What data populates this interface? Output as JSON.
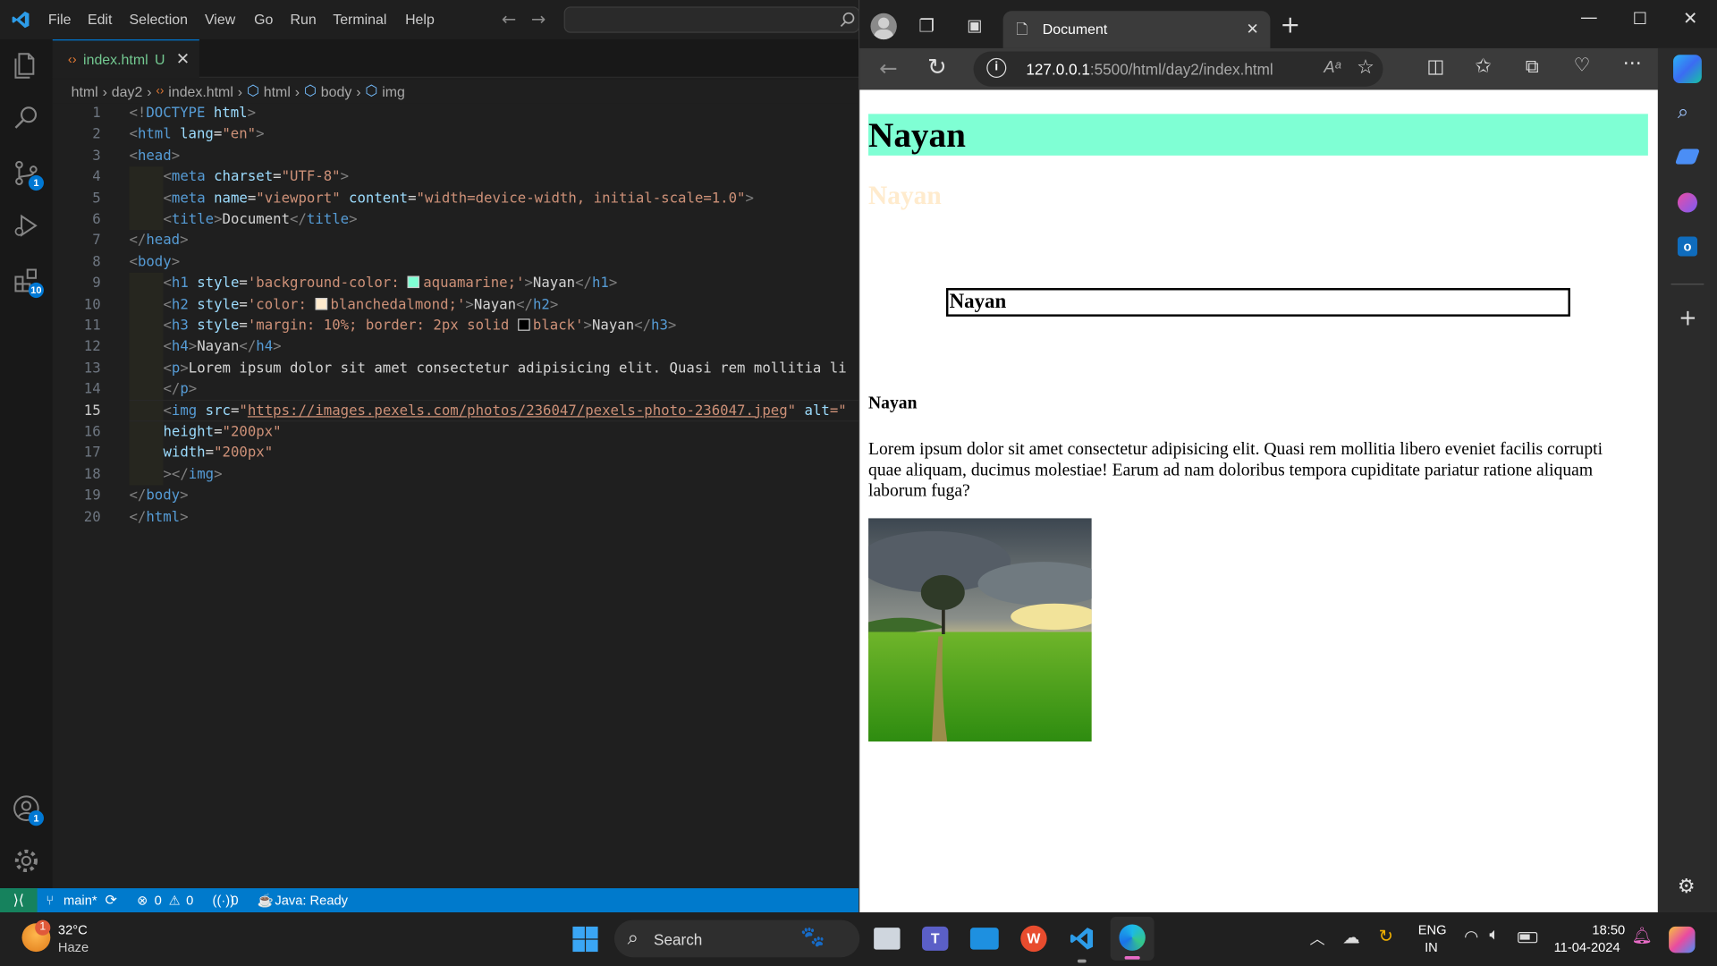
{
  "vscode": {
    "menu": [
      "File",
      "Edit",
      "Selection",
      "View",
      "Go",
      "Run",
      "Terminal",
      "Help"
    ],
    "activity_badges": {
      "scm": "1",
      "extensions": "10",
      "accounts": "1"
    },
    "tab": {
      "label": "index.html",
      "status": "U"
    },
    "breadcrumb": [
      "html",
      "day2",
      "index.html",
      "html",
      "body",
      "img"
    ],
    "line_numbers": [
      "1",
      "2",
      "3",
      "4",
      "5",
      "6",
      "7",
      "8",
      "9",
      "10",
      "11",
      "12",
      "13",
      "14",
      "15",
      "16",
      "17",
      "18",
      "19",
      "20"
    ],
    "current_line": "15",
    "code": {
      "l1": [
        "<!",
        "DOCTYPE",
        " html",
        ">"
      ],
      "l2": [
        "<",
        "html",
        " lang",
        "=",
        "\"en\"",
        ">"
      ],
      "l3": [
        "<",
        "head",
        ">"
      ],
      "l4": [
        "<",
        "meta",
        " charset",
        "=",
        "\"UTF-8\"",
        ">"
      ],
      "l5": [
        "<",
        "meta",
        " name",
        "=",
        "\"viewport\"",
        " content",
        "=",
        "\"width=device-width, initial-scale=1.0\"",
        ">"
      ],
      "l6": [
        "<",
        "title",
        ">",
        "Document",
        "</",
        "title",
        ">"
      ],
      "l7": [
        "</",
        "head",
        ">"
      ],
      "l8": [
        "<",
        "body",
        ">"
      ],
      "l9": [
        "<",
        "h1",
        " style",
        "=",
        "'background-color: ",
        "aquamarine;'",
        ">",
        "Nayan",
        "</",
        "h1",
        ">"
      ],
      "l10": [
        "<",
        "h2",
        " style",
        "=",
        "'color: ",
        "blanchedalmond;'",
        ">",
        "Nayan",
        "</",
        "h2",
        ">"
      ],
      "l11": [
        "<",
        "h3",
        " style",
        "=",
        "'margin: 10%; border: 2px solid ",
        "black'",
        ">",
        "Nayan",
        "</",
        "h3",
        ">"
      ],
      "l12": [
        "<",
        "h4",
        ">",
        "Nayan",
        "</",
        "h4",
        ">"
      ],
      "l13": [
        "<",
        "p",
        ">",
        "Lorem ipsum dolor sit amet consectetur adipisicing elit. Quasi rem mollitia li"
      ],
      "l14": [
        "</",
        "p",
        ">"
      ],
      "l15": [
        "<",
        "img",
        " src",
        "=",
        "\"",
        "https://images.pexels.com/photos/236047/pexels-photo-236047.jpeg",
        "\"",
        " alt",
        "=\""
      ],
      "l16": [
        "height",
        "=",
        "\"200px\""
      ],
      "l17": [
        "width",
        "=",
        "\"200px\""
      ],
      "l18": [
        ">",
        "</",
        "img",
        ">"
      ],
      "l19": [
        "</",
        "body",
        ">"
      ],
      "l20": [
        "</",
        "html",
        ">"
      ]
    },
    "swatches": {
      "aquamarine": "#7fffd4",
      "blanchedalmond": "#ffebcd",
      "black": "#000000"
    },
    "status": {
      "branch": "main*",
      "errors": "0",
      "warnings": "0",
      "ports": "0",
      "java": "Java: Ready"
    }
  },
  "browser": {
    "tab_title": "Document",
    "url_host": "127.0.0.1",
    "url_rest": ":5500/html/day2/index.html",
    "page": {
      "h1": "Nayan",
      "h2": "Nayan",
      "h3": "Nayan",
      "h4": "Nayan",
      "p": "Lorem ipsum dolor sit amet consectetur adipisicing elit. Quasi rem mollitia libero eveniet facilis corrupti quae aliquam, ducimus molestiae! Earum ad nam doloribus tempora cupiditate pariatur ratione aliquam laborum fuga?"
    }
  },
  "taskbar": {
    "weather_temp": "32°C",
    "weather_desc": "Haze",
    "weather_badge": "1",
    "search": "Search",
    "lang1": "ENG",
    "lang2": "IN",
    "time": "18:50",
    "date": "11-04-2024"
  },
  "colors": {
    "accent": "#0078d4",
    "statusbar": "#007acc",
    "h1_bg": "#7fffd4",
    "h2_color": "#ffebcd"
  }
}
